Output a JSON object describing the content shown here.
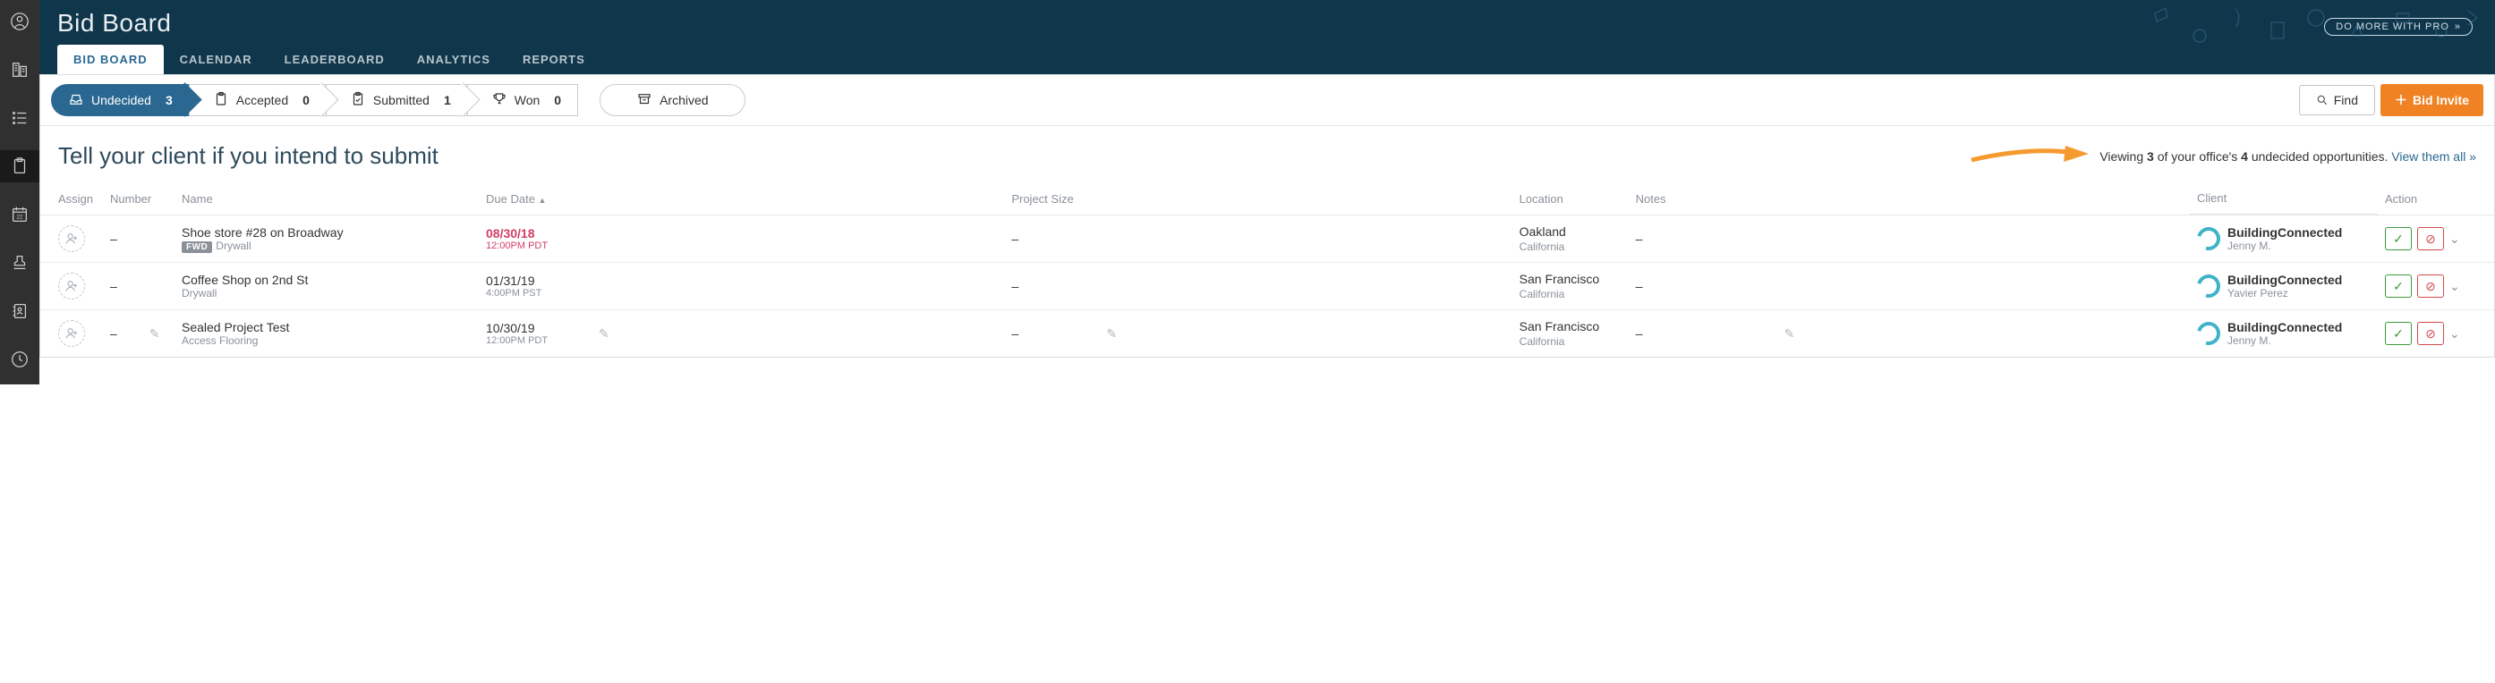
{
  "page_title": "Bid Board",
  "pro_label": "DO MORE WITH PRO",
  "tabs": [
    {
      "label": "BID BOARD",
      "active": true
    },
    {
      "label": "CALENDAR"
    },
    {
      "label": "LEADERBOARD"
    },
    {
      "label": "ANALYTICS"
    },
    {
      "label": "REPORTS"
    }
  ],
  "status": [
    {
      "label": "Undecided",
      "count": "3",
      "selected": true,
      "icon": "tray"
    },
    {
      "label": "Accepted",
      "count": "0",
      "icon": "clipboard"
    },
    {
      "label": "Submitted",
      "count": "1",
      "icon": "clipboard-check"
    },
    {
      "label": "Won",
      "count": "0",
      "icon": "trophy"
    }
  ],
  "archived_label": "Archived",
  "find_label": "Find",
  "bid_invite_label": "Bid Invite",
  "headline": "Tell your client if you intend to submit",
  "viewing": {
    "pre": "Viewing ",
    "n1": "3",
    "mid": " of your office's ",
    "n2": "4",
    "post": " undecided opportunities. ",
    "link": "View them all »"
  },
  "columns": {
    "assign": "Assign",
    "number": "Number",
    "name": "Name",
    "due": "Due Date",
    "psize": "Project Size",
    "location": "Location",
    "notes": "Notes",
    "client": "Client",
    "action": "Action"
  },
  "rows": [
    {
      "number": "–",
      "name": "Shoe store #28 on Broadway",
      "fwd": "FWD",
      "trade": "Drywall",
      "due_date": "08/30/18",
      "due_time": "12:00PM PDT",
      "due_red": true,
      "psize": "–",
      "city": "Oakland",
      "state": "California",
      "notes": "–",
      "client": "BuildingConnected",
      "contact": "Jenny M."
    },
    {
      "number": "–",
      "name": "Coffee Shop on 2nd St",
      "trade": "Drywall",
      "due_date": "01/31/19",
      "due_time": "4:00PM PST",
      "psize": "–",
      "city": "San Francisco",
      "state": "California",
      "notes": "–",
      "client": "BuildingConnected",
      "contact": "Yavier Perez"
    },
    {
      "number": "–",
      "name": "Sealed Project Test",
      "trade": "Access Flooring",
      "due_date": "10/30/19",
      "due_time": "12:00PM PDT",
      "psize": "–",
      "city": "San Francisco",
      "state": "California",
      "notes": "–",
      "client": "BuildingConnected",
      "contact": "Jenny M.",
      "editable": true
    }
  ]
}
